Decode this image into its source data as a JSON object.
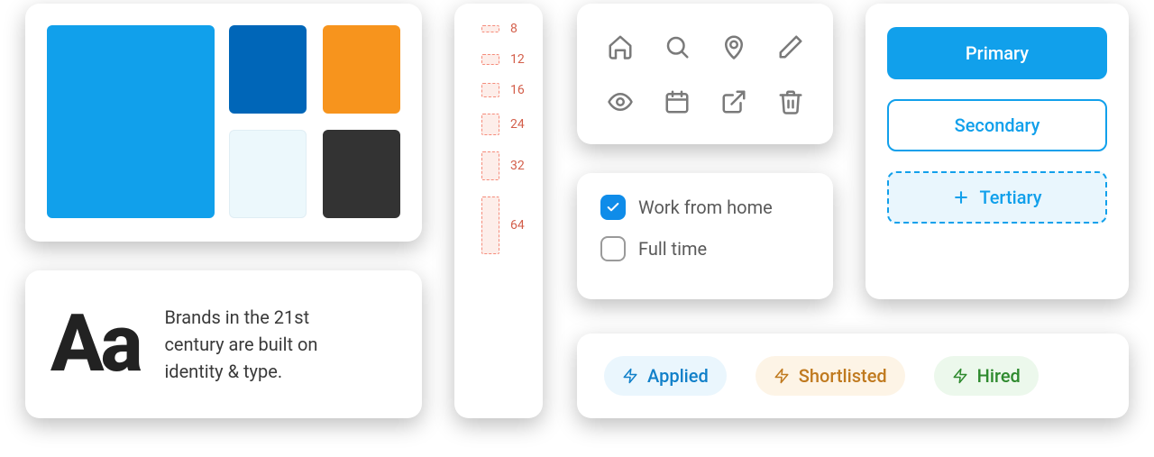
{
  "colors": {
    "primary": "#11a0eb",
    "swatches": [
      "#0066b8",
      "#f7941d",
      "#ecf8fc",
      "#333333"
    ]
  },
  "typography": {
    "sample": "Aa",
    "copy": "Brands in the 21st century are built on identity & type."
  },
  "spacing": [
    {
      "label": "8",
      "size": 8
    },
    {
      "label": "12",
      "size": 12
    },
    {
      "label": "16",
      "size": 16
    },
    {
      "label": "24",
      "size": 24
    },
    {
      "label": "32",
      "size": 32
    },
    {
      "label": "64",
      "size": 64
    }
  ],
  "icons": [
    "home",
    "search",
    "map-pin",
    "pencil",
    "eye",
    "calendar",
    "external-link",
    "trash"
  ],
  "checkboxes": [
    {
      "label": "Work from home",
      "checked": true
    },
    {
      "label": "Full time",
      "checked": false
    }
  ],
  "buttons": {
    "primary": "Primary",
    "secondary": "Secondary",
    "tertiary": "Tertiary"
  },
  "tags": [
    {
      "label": "Applied",
      "variant": "blue"
    },
    {
      "label": "Shortlisted",
      "variant": "orange"
    },
    {
      "label": "Hired",
      "variant": "green"
    }
  ]
}
